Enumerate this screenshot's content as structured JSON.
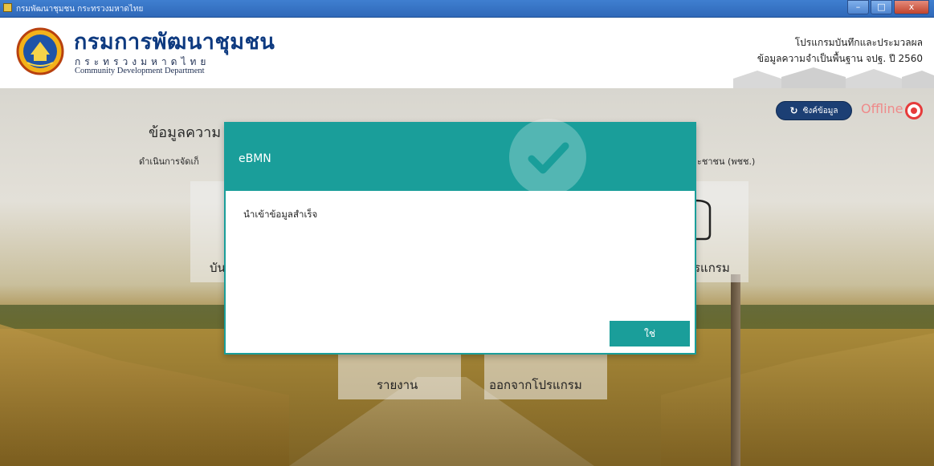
{
  "window": {
    "title": "กรมพัฒนาชุมชน กระทรวงมหาดไทย",
    "controls": {
      "minimize": "–",
      "maximize": "□",
      "close": "x"
    }
  },
  "header": {
    "org_name_th": "กรมการพัฒนาชุมชน",
    "ministry_th": "กระทรวงมหาดไทย",
    "org_name_en": "Community Development Department",
    "program_title": "โปรแกรมบันทึกและประมวลผล",
    "program_subtitle": "ข้อมูลความจำเป็นพื้นฐาน จปฐ. ปี 2560"
  },
  "toolbar": {
    "sync_label": "ซิงค์ข้อมูล",
    "status_label": "Offline"
  },
  "page": {
    "heading": "ข้อมูลความ",
    "subtitle": "ดำเนินการจัดเก็",
    "subtitle_right": "ะชาชน (พชช.)"
  },
  "tiles": {
    "record_partial": "บัน",
    "program_partial": "รแกรม",
    "report": "รายงาน",
    "exit": "ออกจากโปรแกรม"
  },
  "dialog": {
    "title": "eBMN",
    "message": "นำเข้าข้อมูลสำเร็จ",
    "ok_label": "ใช่"
  },
  "colors": {
    "accent": "#1a9e9a",
    "sync_button": "#1c3f74",
    "offline": "#e63b3b",
    "brand": "#0e3a80"
  }
}
